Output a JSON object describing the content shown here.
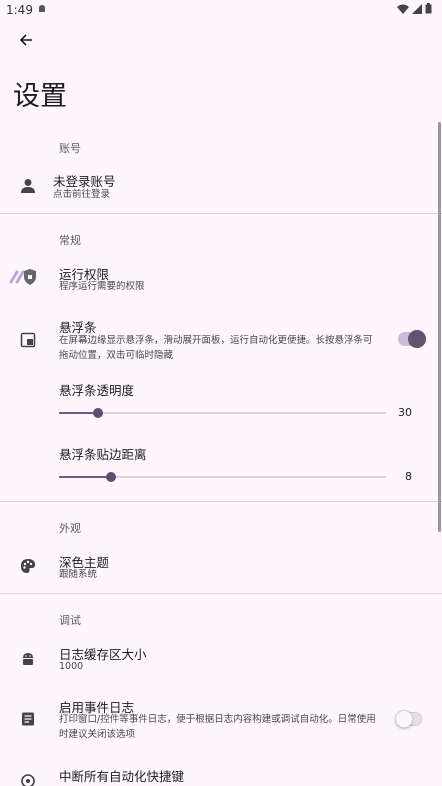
{
  "status": {
    "time": "1:49"
  },
  "page": {
    "title": "设置"
  },
  "sections": {
    "account": "账号",
    "general": "常规",
    "appearance": "外观",
    "debug": "调试"
  },
  "account": {
    "title": "未登录账号",
    "subtitle": "点击前往登录"
  },
  "permissions": {
    "title": "运行权限",
    "subtitle": "程序运行需要的权限"
  },
  "floating_bar": {
    "title": "悬浮条",
    "subtitle": "在屏幕边缘显示悬浮条，滑动展开面板，运行自动化更便捷。长按悬浮条可拖动位置，双击可临时隐藏",
    "enabled": true
  },
  "opacity": {
    "title": "悬浮条透明度",
    "value": "30",
    "fraction": 0.12
  },
  "edge_distance": {
    "title": "悬浮条贴边距离",
    "value": "8",
    "fraction": 0.16
  },
  "dark_theme": {
    "title": "深色主题",
    "subtitle": "跟随系统"
  },
  "log_buffer": {
    "title": "日志缓存区大小",
    "subtitle": "1000"
  },
  "event_log": {
    "title": "启用事件日志",
    "subtitle": "打印窗口/控件等事件日志，便于根据日志内容构建或调试自动化。日常使用时建议关闭该选项",
    "enabled": false
  },
  "interrupt": {
    "title": "中断所有自动化快捷键"
  },
  "colors": {
    "accent": "#5e5470",
    "background": "#fdf7fd"
  }
}
